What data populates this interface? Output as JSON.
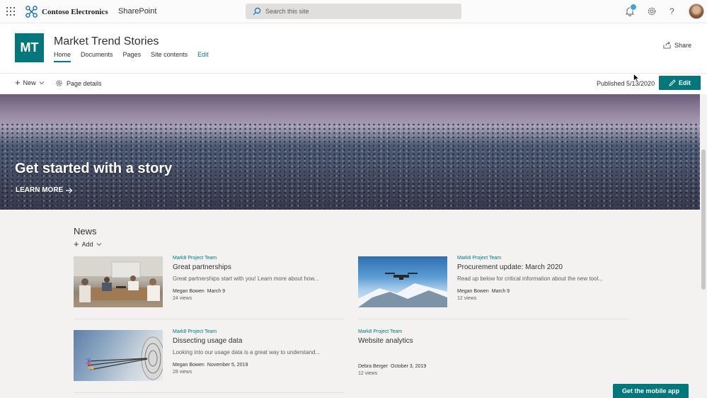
{
  "suite": {
    "company": "Contoso Electronics",
    "app": "SharePoint",
    "search_placeholder": "Search this site",
    "accent": "#03787c",
    "notification_badge_color": "#41a4dd",
    "help_glyph": "?"
  },
  "site": {
    "logo_initials": "MT",
    "title": "Market Trend Stories",
    "nav": [
      "Home",
      "Documents",
      "Pages",
      "Site contents",
      "Edit"
    ],
    "share_label": "Share"
  },
  "commandbar": {
    "new_label": "New",
    "page_details_label": "Page details",
    "published": "Published 5/13/2020",
    "edit_label": "Edit"
  },
  "hero": {
    "title": "Get started with a story",
    "link": "LEARN MORE"
  },
  "news": {
    "title": "News",
    "add_label": "Add",
    "items": [
      {
        "site": "Mark8 Project Team",
        "title": "Great partnerships",
        "description": "Great partnerships start with you!  Learn more about how...",
        "author": "Megan Bowen",
        "date": "March 9",
        "views": "24 views",
        "image": "meeting-photo"
      },
      {
        "site": "Mark8 Project Team",
        "title": "Procurement update: March 2020",
        "description": "Read up below for critical information about the new tool...",
        "author": "Megan Bowen",
        "date": "March 9",
        "views": "12 views",
        "image": "drone-photo"
      },
      {
        "site": "Mark8 Project Team",
        "title": "Dissecting usage data",
        "description": "Looking into our usage data is a great way to understand...",
        "author": "Megan Bowen",
        "date": "November 5, 2019",
        "views": "28 views",
        "image": "target-arrows-photo"
      },
      {
        "site": "Mark8 Project Team",
        "title": "Website analytics",
        "description": "",
        "author": "Debra Berger",
        "date": "October 3, 2019",
        "views": "12 views",
        "image": "none"
      }
    ]
  },
  "footer": {
    "mobile_app_label": "Get the mobile app"
  }
}
